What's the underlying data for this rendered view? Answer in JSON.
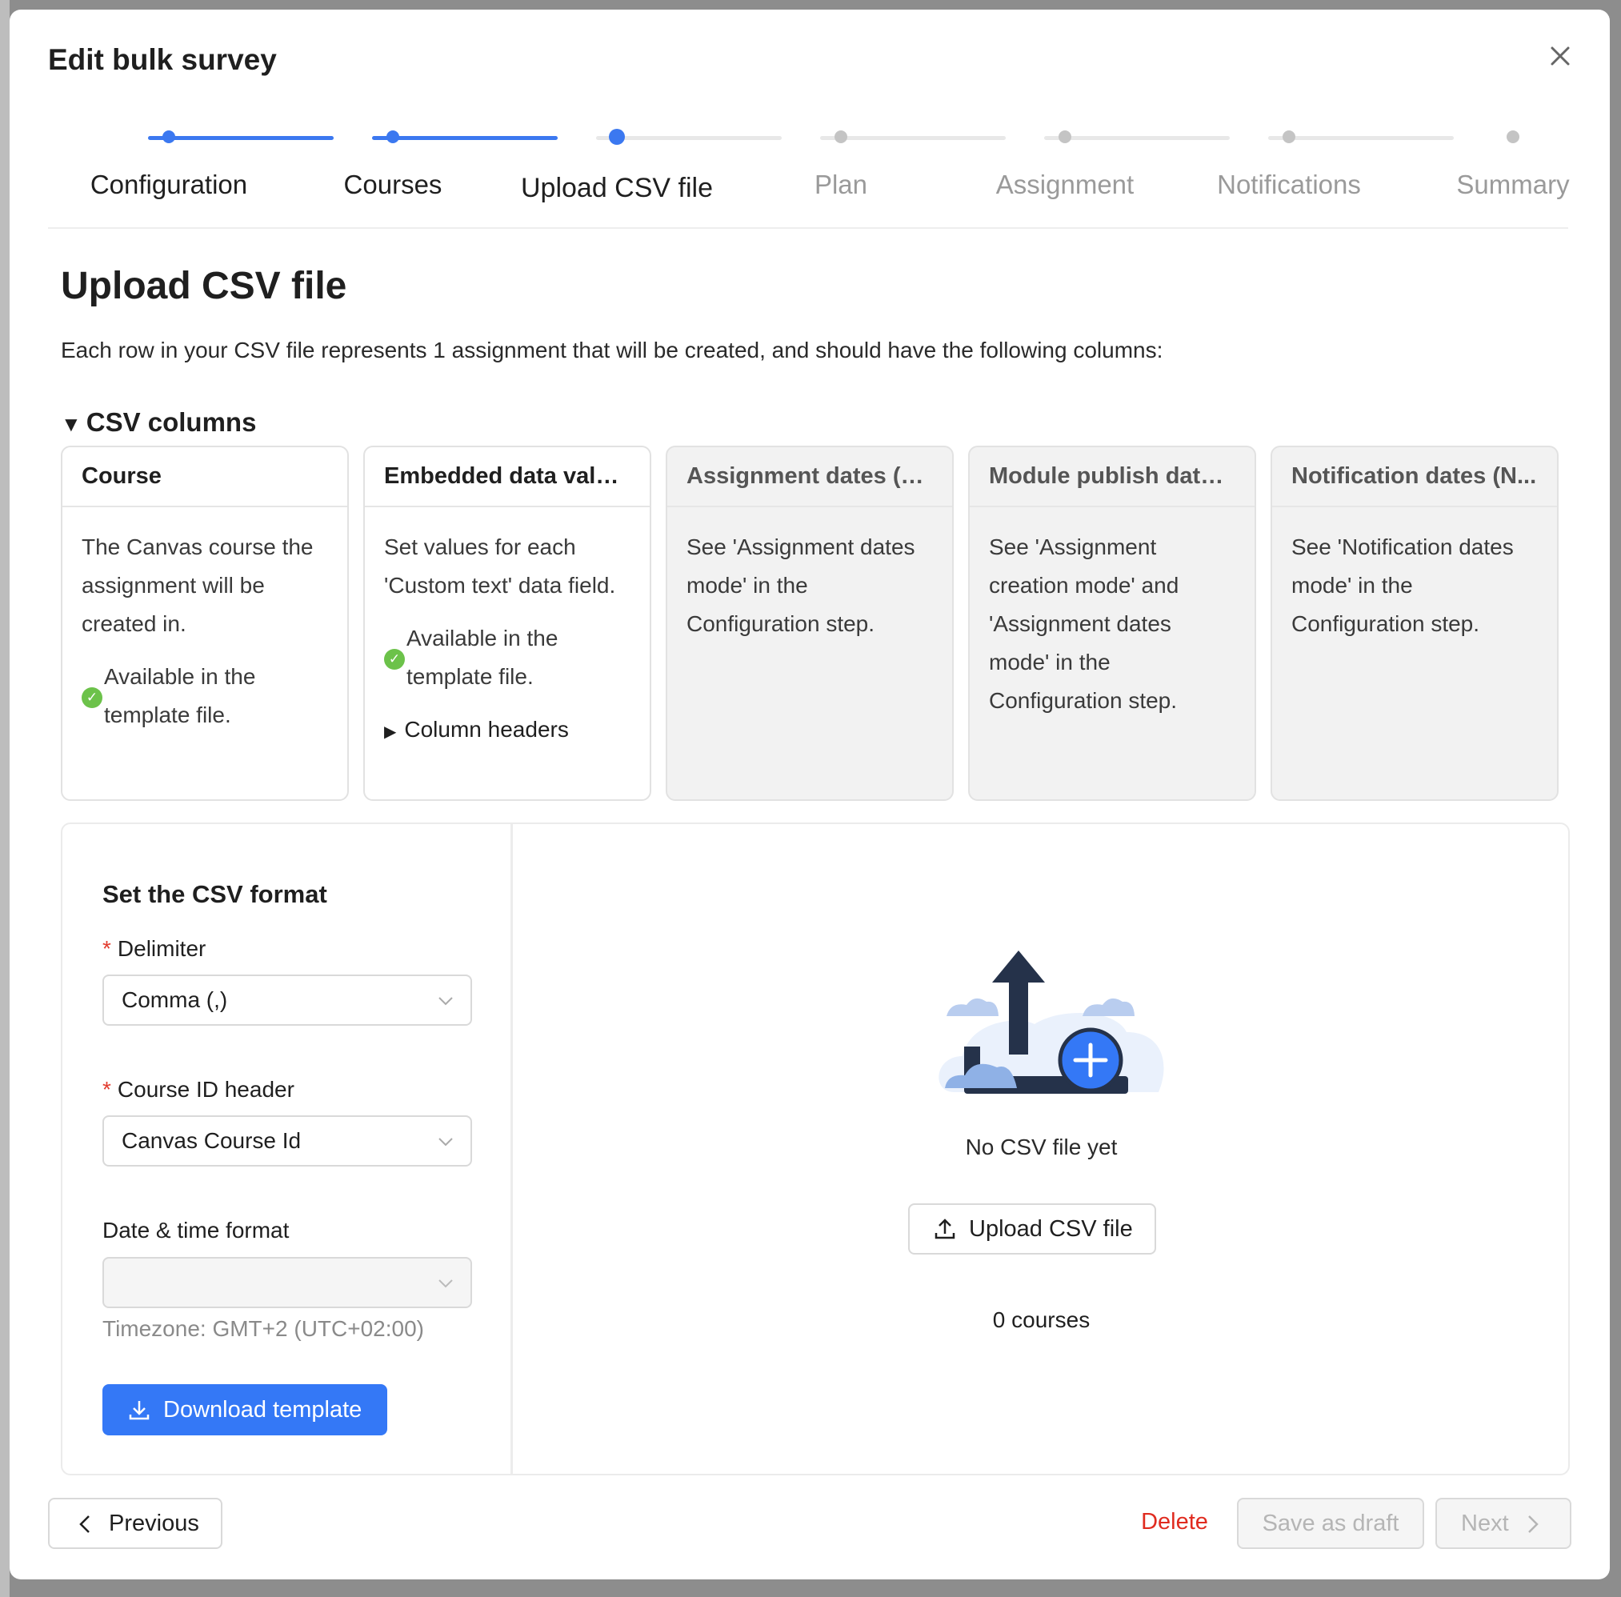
{
  "modal": {
    "title": "Edit bulk survey"
  },
  "stepper": {
    "steps": [
      {
        "label": "Configuration",
        "state": "done"
      },
      {
        "label": "Courses",
        "state": "done"
      },
      {
        "label": "Upload CSV file",
        "state": "current"
      },
      {
        "label": "Plan",
        "state": "pending"
      },
      {
        "label": "Assignment",
        "state": "pending"
      },
      {
        "label": "Notifications",
        "state": "pending"
      },
      {
        "label": "Summary",
        "state": "pending"
      }
    ]
  },
  "page": {
    "heading": "Upload CSV file",
    "description": "Each row in your CSV file represents 1 assignment that will be created, and should have the following columns:"
  },
  "csv_columns": {
    "toggle_label": "CSV columns",
    "cards": [
      {
        "title": "Course",
        "body": "The Canvas course the assignment will be created in.",
        "available": "Available in the template file."
      },
      {
        "title": "Embedded data values",
        "body": "Set values for each 'Custom text' data field.",
        "available": "Available in the template file.",
        "extra": "Column headers"
      },
      {
        "title": "Assignment dates (N...",
        "body": "See 'Assignment dates mode' in the Configuration step."
      },
      {
        "title": "Module publish date ...",
        "body": "See 'Assignment creation mode' and 'Assignment dates mode' in the Configuration step."
      },
      {
        "title": "Notification dates (N...",
        "body": "See 'Notification dates mode' in the Configuration step."
      }
    ]
  },
  "format": {
    "title": "Set the CSV format",
    "required_mark": "*",
    "delimiter_label": "Delimiter",
    "delimiter_value": "Comma (,)",
    "course_id_label": "Course ID header",
    "course_id_value": "Canvas Course Id",
    "datetime_label": "Date & time format",
    "datetime_value": "",
    "timezone": "Timezone: GMT+2 (UTC+02:00)",
    "download_label": "Download template"
  },
  "upload": {
    "empty_text": "No CSV file yet",
    "button_label": "Upload CSV file",
    "courses_count": "0 courses"
  },
  "footer": {
    "previous": "Previous",
    "delete": "Delete",
    "save_draft": "Save as draft",
    "next": "Next"
  },
  "colors": {
    "accent": "#3478f6",
    "danger": "#e02b1f",
    "success": "#6cc24a"
  }
}
